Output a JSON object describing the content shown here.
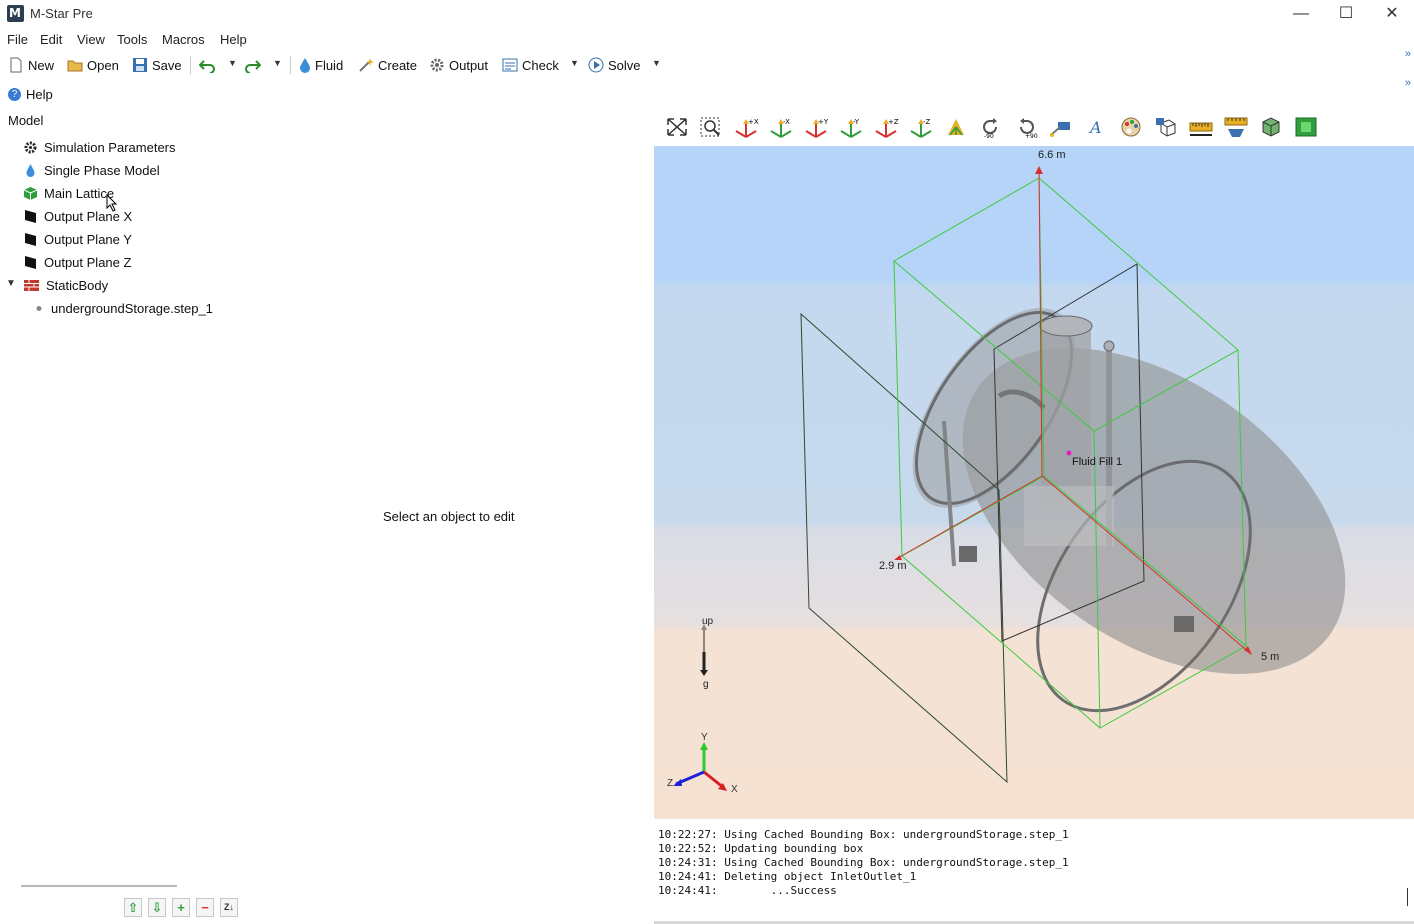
{
  "app": {
    "title": "M-Star Pre"
  },
  "window_controls": {
    "minimize": "—",
    "maximize": "☐",
    "close": "✕"
  },
  "menu": [
    "File",
    "Edit",
    "View",
    "Tools",
    "Macros",
    "Help"
  ],
  "toolbar": {
    "new_label": "New",
    "open_label": "Open",
    "save_label": "Save",
    "fluid_label": "Fluid",
    "create_label": "Create",
    "output_label": "Output",
    "check_label": "Check",
    "solve_label": "Solve"
  },
  "help": {
    "label": "Help"
  },
  "tree": {
    "root_label": "Model",
    "items": [
      {
        "label": "Simulation Parameters",
        "icon": "gear-icon"
      },
      {
        "label": "Single Phase Model",
        "icon": "droplet-icon"
      },
      {
        "label": "Main Lattice",
        "icon": "cube-icon"
      },
      {
        "label": "Output Plane X",
        "icon": "plane-icon"
      },
      {
        "label": "Output Plane Y",
        "icon": "plane-icon"
      },
      {
        "label": "Output Plane Z",
        "icon": "plane-icon"
      },
      {
        "label": "StaticBody",
        "icon": "brick-wall-icon"
      },
      {
        "label": "undergroundStorage.step_1",
        "icon": "dot-icon"
      }
    ]
  },
  "editor": {
    "hint": "Select an object to edit"
  },
  "viewport": {
    "label_top": "6.6 m",
    "label_left": "2.9 m",
    "label_right": "5 m",
    "fluid_fill": "Fluid Fill 1",
    "gravity_up": "up",
    "gravity_g": "g",
    "axis_x": "X",
    "axis_y": "Y",
    "axis_z": "Z",
    "colors": {
      "sky": "#b6d5f7",
      "floor": "#f5e2d3",
      "bbox": "#3ccb3c",
      "body": "#8a8a8a"
    }
  },
  "log": {
    "lines": [
      "10:22:27: Using Cached Bounding Box: undergroundStorage.step_1",
      "10:22:52: Updating bounding box",
      "10:24:31: Using Cached Bounding Box: undergroundStorage.step_1",
      "10:24:41: Deleting object InletOutlet_1",
      "10:24:41:        ...Success"
    ]
  },
  "list_buttons": {
    "up": "⇧",
    "down": "⇩",
    "add": "+",
    "remove": "−",
    "sort": "Z↓"
  }
}
